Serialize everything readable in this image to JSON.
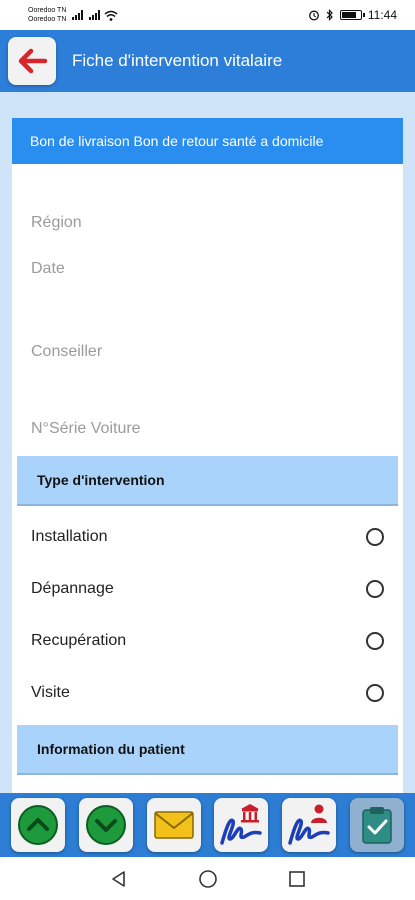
{
  "status_bar": {
    "carrier_1": "Ooredoo TN",
    "carrier_2": "Ooredoo TN",
    "time": "11:44"
  },
  "app_bar": {
    "title": "Fiche d'intervention vitalaire",
    "back_icon": "arrow-left-icon"
  },
  "form": {
    "header": "Bon de livraison Bon de retour santé a domicile",
    "fields": [
      "Région",
      "Date",
      "Conseiller",
      "N°Série Voiture"
    ],
    "intervention_section": "Type d'intervention",
    "intervention_options": [
      "Installation",
      "Dépannage",
      "Recupération",
      "Visite"
    ],
    "patient_section": "Information du patient"
  },
  "toolbar": {
    "buttons": [
      "scroll-up-icon",
      "scroll-down-icon",
      "mail-icon",
      "signature-building-icon",
      "signature-person-icon",
      "clipboard-check-icon"
    ]
  },
  "colors": {
    "primary": "#2d7ed8",
    "header_blue": "#2a8ef0",
    "section_blue": "#aad3fb",
    "background": "#cfe4f8"
  }
}
